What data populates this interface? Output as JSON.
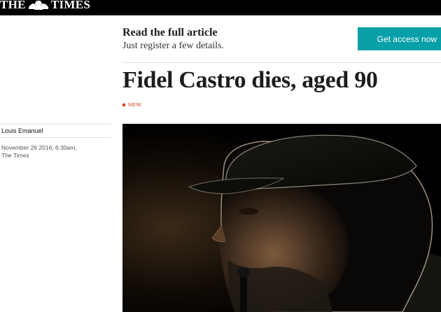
{
  "masthead": {
    "prefix": "THE",
    "crest_icon": "royal-crest-icon",
    "suffix": "TIMES"
  },
  "register": {
    "heading": "Read the full article",
    "subheading": "Just register a few details.",
    "button_label": "Get access now"
  },
  "article": {
    "headline": "Fidel Castro dies, aged 90",
    "tag": "NEW",
    "author": "Louis Emanuel",
    "dateline_1": "November 26 2016, 6:30am,",
    "dateline_2": "The Times"
  },
  "colors": {
    "topbar": "#000000",
    "button": "#07a0a8",
    "tag": "#d2411d",
    "headline": "#1d1d1b"
  }
}
